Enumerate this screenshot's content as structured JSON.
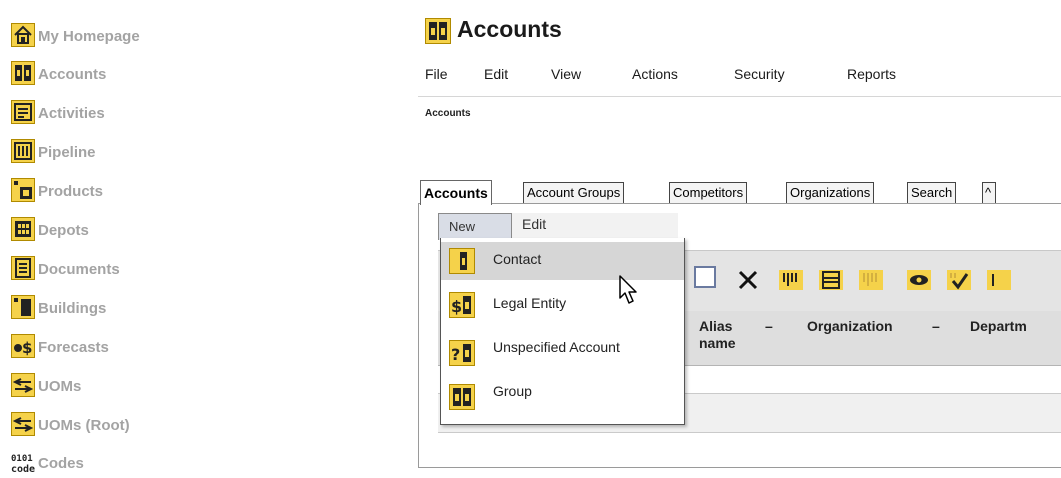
{
  "sidebar": {
    "items": [
      {
        "label": "My Homepage",
        "icon": "home-icon"
      },
      {
        "label": "Accounts",
        "icon": "accounts-icon"
      },
      {
        "label": "Activities",
        "icon": "activities-icon"
      },
      {
        "label": "Pipeline",
        "icon": "pipeline-icon"
      },
      {
        "label": "Products",
        "icon": "products-icon"
      },
      {
        "label": "Depots",
        "icon": "depots-icon"
      },
      {
        "label": "Documents",
        "icon": "documents-icon"
      },
      {
        "label": "Buildings",
        "icon": "buildings-icon"
      },
      {
        "label": "Forecasts",
        "icon": "forecasts-icon"
      },
      {
        "label": "UOMs",
        "icon": "uom-icon"
      },
      {
        "label": "UOMs (Root)",
        "icon": "uom-icon"
      },
      {
        "label": "Codes",
        "icon": "codes-icon"
      }
    ],
    "codes_icon_text": "0101\ncode"
  },
  "page": {
    "title": "Accounts",
    "breadcrumb": "Accounts"
  },
  "menubar": [
    "File",
    "Edit",
    "View",
    "Actions",
    "Security",
    "Reports"
  ],
  "tabs": [
    "Accounts",
    "Account Groups",
    "Competitors",
    "Organizations",
    "Search",
    "^"
  ],
  "subbar": {
    "new_label": "New",
    "edit_label": "Edit"
  },
  "dropdown": {
    "items": [
      {
        "label": "Contact",
        "icon": "contact-icon"
      },
      {
        "label": "Legal Entity",
        "icon": "legal-entity-icon"
      },
      {
        "label": "Unspecified Account",
        "icon": "unspecified-account-icon"
      },
      {
        "label": "Group",
        "icon": "group-icon"
      }
    ],
    "hovered_item": "Contact"
  },
  "grid": {
    "columns": [
      "Alias name",
      "Organization",
      "Departm"
    ],
    "sort_marker": "–"
  },
  "colors": {
    "icon_yellow": "#f5d24a",
    "sidebar_text": "#a3a3a3",
    "menu_hover": "#d6d6d6"
  }
}
